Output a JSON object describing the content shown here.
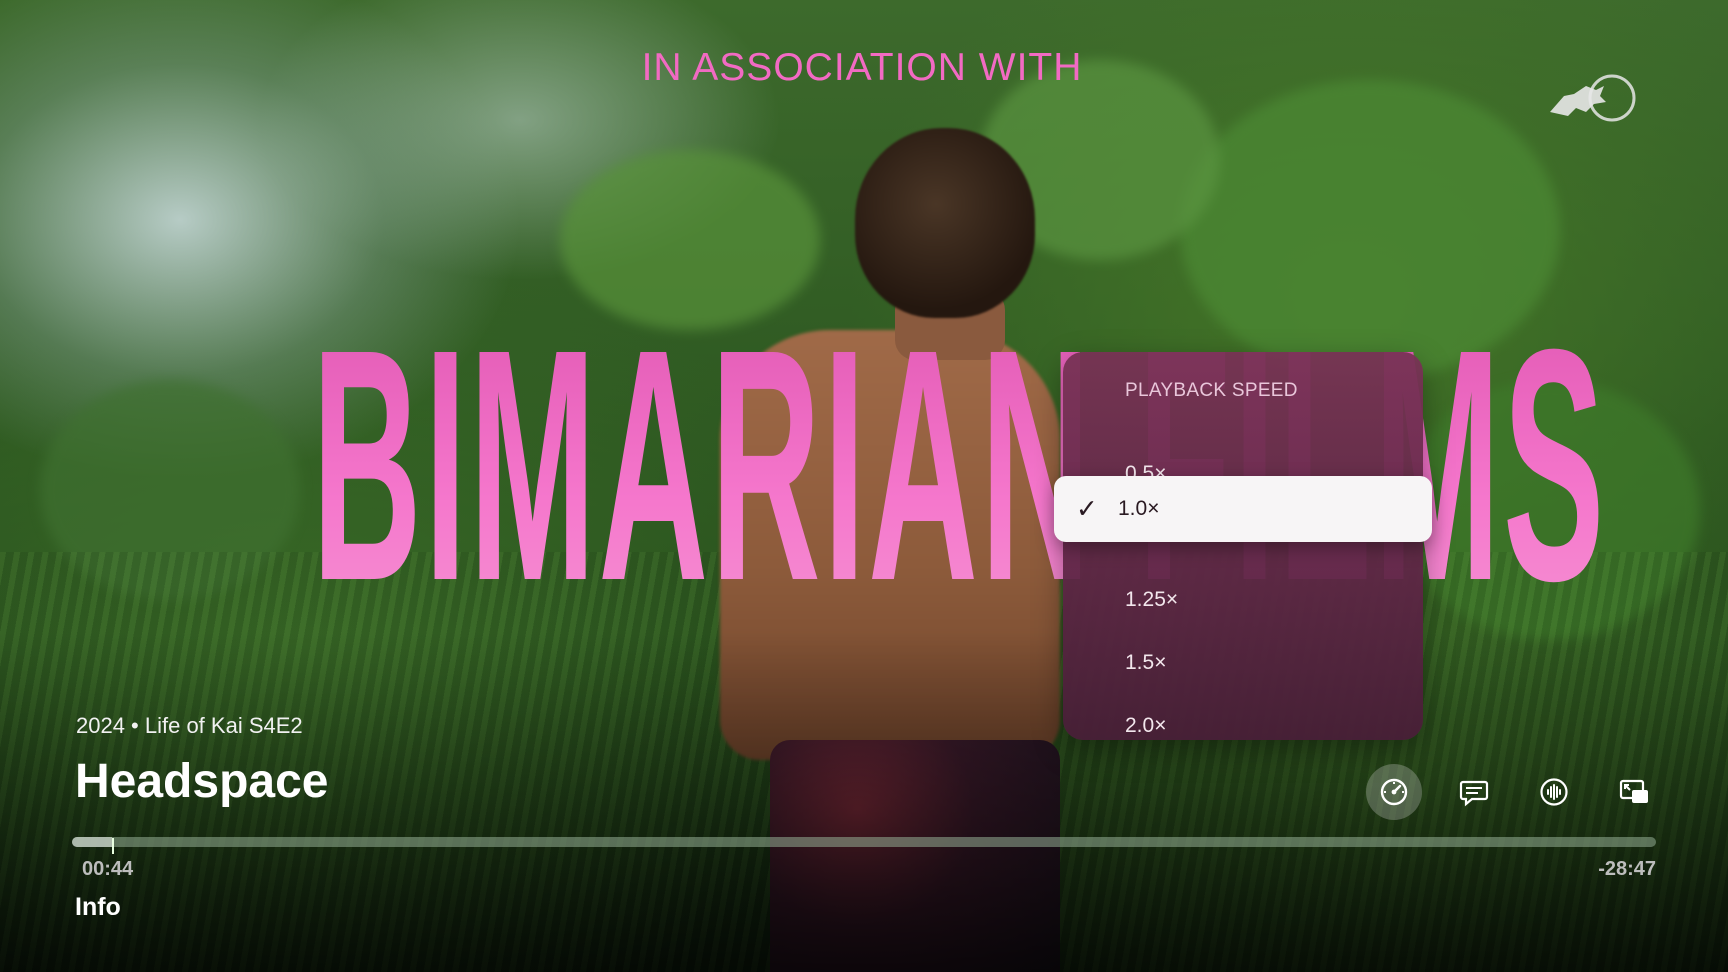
{
  "overlay": {
    "association_text": "IN ASSOCIATION WITH",
    "big_title": "BIMARIAN FILMS"
  },
  "speed_menu": {
    "title": "PLAYBACK SPEED",
    "options": [
      {
        "label": "0.5×",
        "selected": false
      },
      {
        "label": "1.0×",
        "selected": true
      },
      {
        "label": "1.25×",
        "selected": false
      },
      {
        "label": "1.5×",
        "selected": false
      },
      {
        "label": "2.0×",
        "selected": false
      }
    ]
  },
  "episode": {
    "meta": "2024 • Life of Kai S4E2",
    "title": "Headspace"
  },
  "playback": {
    "elapsed": "00:44",
    "remaining": "-28:47",
    "progress_fraction": 0.025
  },
  "tabs": {
    "info": "Info"
  },
  "controls": [
    {
      "icon": "playback-speed-icon",
      "active": true
    },
    {
      "icon": "subtitles-icon",
      "active": false
    },
    {
      "icon": "audio-icon",
      "active": false
    },
    {
      "icon": "picture-in-picture-icon",
      "active": false
    }
  ],
  "colors": {
    "accent_pink": "#f26ac3",
    "menu_bg": "#7a3256",
    "progress_track": "#8fae8f"
  }
}
